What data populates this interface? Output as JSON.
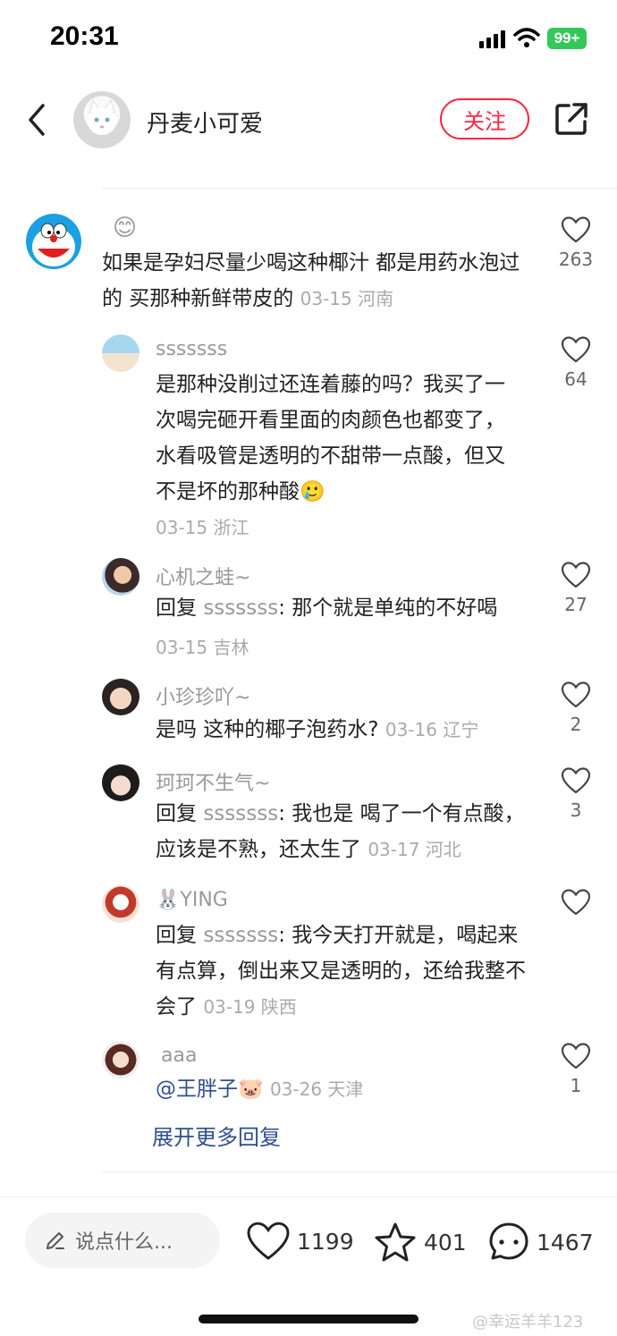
{
  "status": {
    "time": "20:31",
    "battery": "99+"
  },
  "header": {
    "author": "丹麦小可爱",
    "follow_label": "关注"
  },
  "comments": [
    {
      "username": "😊",
      "text": "如果是孕妇尽量少喝这种椰汁 都是用药水泡过的 买那种新鲜带皮的",
      "date": "03-15 河南",
      "likes": "263"
    },
    {
      "username": "sssssss",
      "text": "是那种没削过还连着藤的吗？我买了一次喝完砸开看里面的肉颜色也都变了，水看吸管是透明的不甜带一点酸，但又不是坏的那种酸🥲",
      "date": "03-15 浙江",
      "likes": "64"
    },
    {
      "username": "心机之蛙~",
      "reply_prefix": "回复 ",
      "reply_to": "sssssss",
      "text": ": 那个就是单纯的不好喝",
      "date": "03-15 吉林",
      "likes": "27"
    },
    {
      "username": "小珍珍吖~",
      "text": "是吗 这种的椰子泡药水?",
      "date": "03-16 辽宁",
      "likes": "2"
    },
    {
      "username": "珂珂不生气~",
      "reply_prefix": "回复 ",
      "reply_to": "sssssss",
      "text": ": 我也是 喝了一个有点酸，应该是不熟，还太生了",
      "date": "03-17 河北",
      "likes": "3"
    },
    {
      "username": "🐰YING",
      "reply_prefix": "回复 ",
      "reply_to": "sssssss",
      "text": ": 我今天打开就是，喝起来有点算，倒出来又是透明的，还给我整不会了",
      "date": "03-19 陕西",
      "likes": ""
    },
    {
      "username": "aaa",
      "mention": "@王胖子🐷",
      "date": "03-26 天津",
      "likes": "1"
    }
  ],
  "expand_label": "展开更多回复",
  "bottom": {
    "placeholder": "说点什么...",
    "like_count": "1199",
    "star_count": "401",
    "comment_count": "1467"
  },
  "watermark": "@幸运羊羊123",
  "colors": {
    "accent": "#ff2442",
    "link": "#2f4f8f",
    "battery": "#34c759"
  }
}
